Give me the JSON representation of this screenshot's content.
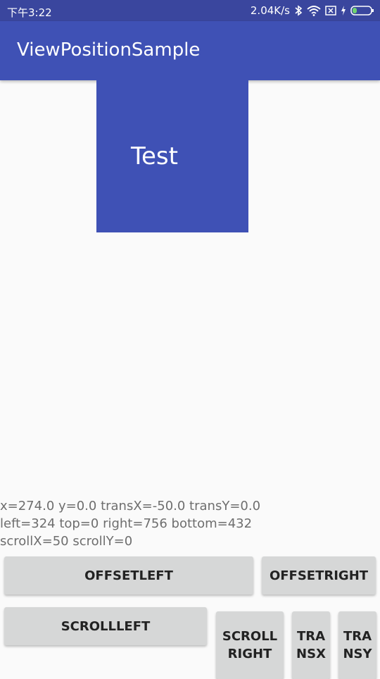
{
  "status_bar": {
    "time": "下午3:22",
    "speed": "2.04K/s",
    "icons": [
      "bluetooth-icon",
      "wifi-icon",
      "sim-x-icon",
      "charging-icon",
      "battery-icon"
    ]
  },
  "app_bar": {
    "title": "ViewPositionSample"
  },
  "test_view": {
    "label": "Test",
    "color": "#3f51b5"
  },
  "info": {
    "line1": "x=274.0 y=0.0 transX=-50.0 transY=0.0",
    "line2": "left=324 top=0 right=756 bottom=432",
    "line3": "scrollX=50 scrollY=0"
  },
  "buttons": {
    "offset_left": "OFFSETLEFT",
    "offset_right": "OFFSETRIGHT",
    "scroll_left": "SCROLLLEFT",
    "scroll_right": "SCROLLRIGHT",
    "trans_x": "TRANSX",
    "trans_y": "TRANSY"
  },
  "colors": {
    "primary": "#3f51b5",
    "primary_dark": "#3a469e",
    "background": "#fafafa",
    "button": "#d6d7d7"
  }
}
